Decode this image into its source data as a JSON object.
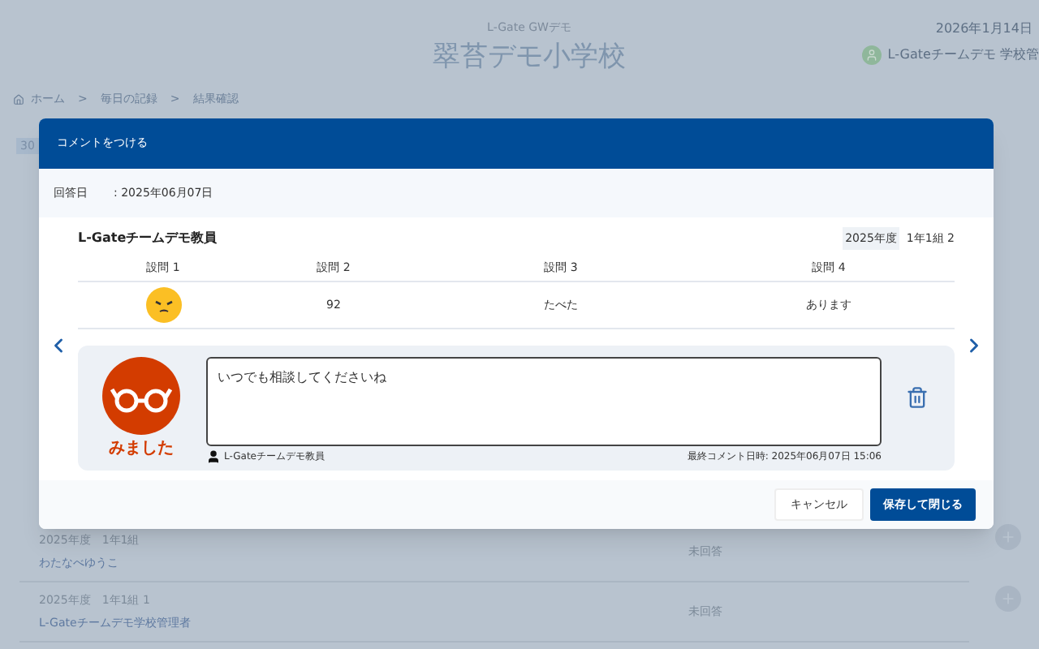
{
  "page": {
    "app_name": "L-Gate GWデモ",
    "school": "翠苔デモ小学校",
    "date": "2026年1月14日",
    "user": "L-Gateチームデモ 学校管",
    "breadcrumb": [
      "ホーム",
      "毎日の記録",
      "結果確認"
    ],
    "separator": ">",
    "day_badge": "30",
    "rows": [
      {
        "term": "2025年度",
        "class": "1年1組",
        "name": "わたなべゆうこ",
        "status": "未回答"
      },
      {
        "term": "2025年度",
        "class": "1年1組 1",
        "name": "L-Gateチームデモ学校管理者",
        "status": "未回答"
      }
    ]
  },
  "dialog": {
    "title": "コメントをつける",
    "answer_date_label": "回答日",
    "answer_date": ": 2025年06月07日",
    "student": "L-Gateチームデモ教員",
    "year": "2025年度",
    "class": "1年1組 2",
    "columns": [
      "設問 1",
      "設問 2",
      "設問 3",
      "設問 4"
    ],
    "answers": [
      {
        "kind": "face"
      },
      {
        "kind": "text",
        "value": "92"
      },
      {
        "kind": "text",
        "value": "たべた"
      },
      {
        "kind": "text",
        "value": "あります"
      }
    ],
    "stamp": "みました",
    "comment": "いつでも相談してくださいね",
    "commenter": "L-Gateチームデモ教員",
    "last_comment": "最終コメント日時: 2025年06月07日 15:06",
    "buttons": [
      {
        "label": "キャンセル",
        "primary": false
      },
      {
        "label": "保存して閉じる",
        "primary": true
      }
    ]
  }
}
